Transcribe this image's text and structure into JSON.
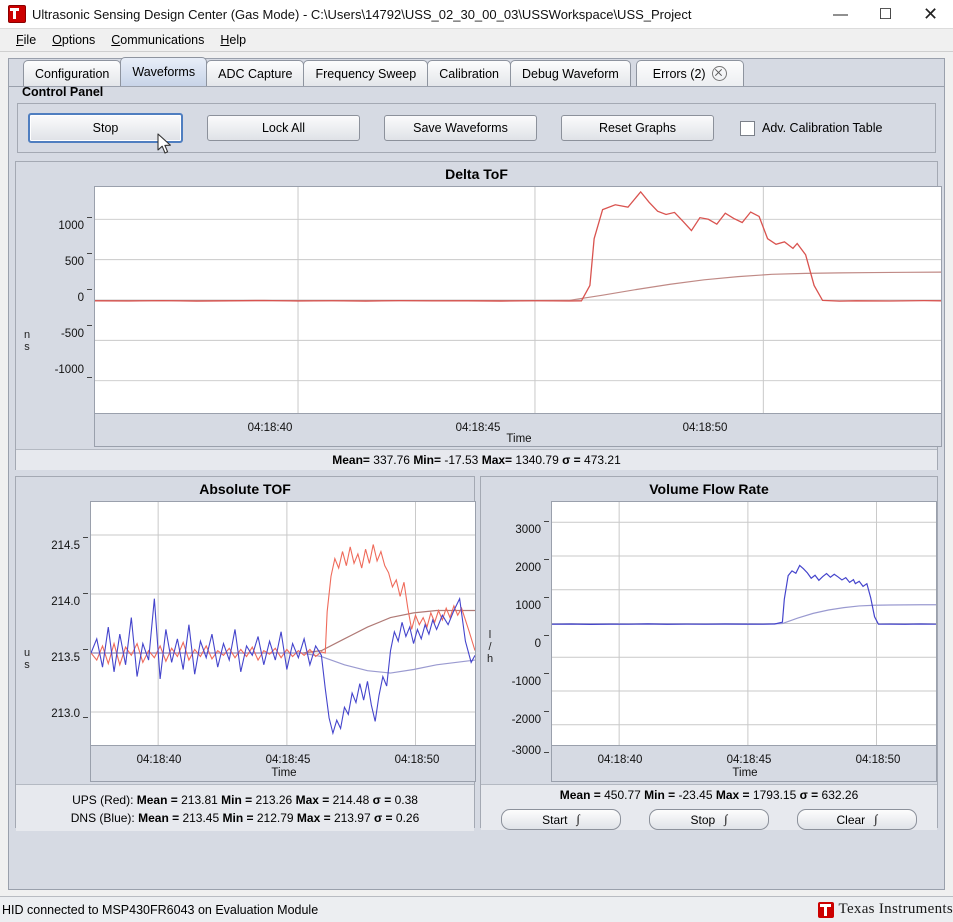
{
  "window": {
    "title": "Ultrasonic Sensing Design Center (Gas Mode) - C:\\Users\\14792\\USS_02_30_00_03\\USSWorkspace\\USS_Project",
    "icon": "app-icon",
    "minimize": "—",
    "maximize": "☐",
    "close": "✕"
  },
  "menu": [
    {
      "label": "File"
    },
    {
      "label": "Options"
    },
    {
      "label": "Communications"
    },
    {
      "label": "Help"
    }
  ],
  "tabs": [
    {
      "label": "Configuration",
      "active": false
    },
    {
      "label": "Waveforms",
      "active": true
    },
    {
      "label": "ADC Capture",
      "active": false
    },
    {
      "label": "Frequency Sweep",
      "active": false
    },
    {
      "label": "Calibration",
      "active": false
    },
    {
      "label": "Debug Waveform",
      "active": false
    },
    {
      "label": "Errors (2)",
      "active": false,
      "closable": true
    }
  ],
  "control_panel": {
    "title": "Control Panel",
    "stop_button": "Stop",
    "lock_all_button": "Lock All",
    "save_waveforms_button": "Save Waveforms",
    "reset_graphs_button": "Reset Graphs",
    "adv_calibration_checkbox": "Adv. Calibration Table",
    "adv_calibration_checked": false
  },
  "delta_tof": {
    "title": "Delta ToF",
    "stats": {
      "mean_label": "Mean=",
      "mean": "337.76",
      "min_label": "Min=",
      "min": "-17.53",
      "max_label": "Max=",
      "max": "1340.79",
      "sigma_label": "σ =",
      "sigma": "473.21"
    }
  },
  "absolute_tof": {
    "title": "Absolute TOF",
    "ups_label": "UPS (Red):",
    "ups": {
      "mean_label": "Mean =",
      "mean": "213.81",
      "min_label": "Min =",
      "min": "213.26",
      "max_label": "Max =",
      "max": "214.48",
      "sigma_label": "σ =",
      "sigma": "0.38"
    },
    "dns_label": "DNS (Blue):",
    "dns": {
      "mean_label": "Mean =",
      "mean": "213.45",
      "min_label": "Min =",
      "min": "212.79",
      "max_label": "Max =",
      "max": "213.97",
      "sigma_label": "σ =",
      "sigma": "0.26"
    }
  },
  "volume_flow_rate": {
    "title": "Volume Flow Rate",
    "stats": {
      "mean_label": "Mean =",
      "mean": "450.77",
      "min_label": "Min =",
      "min": "-23.45",
      "max_label": "Max =",
      "max": "1793.15",
      "sigma_label": "σ =",
      "sigma": "632.26"
    },
    "start_button": "Start",
    "stop_button": "Stop",
    "clear_button": "Clear",
    "totalizer_glyph": "∫"
  },
  "statusbar": {
    "text": "HID connected to MSP430FR6043 on Evaluation Module",
    "brand": "Texas Instruments"
  },
  "colors": {
    "ups_red": "#d9534f",
    "dns_blue": "#4444cc",
    "avg_red": "#c08a86",
    "avg_blue": "#9a9ad0",
    "panel": "#d6dae3",
    "plot_bg": "#ffffff",
    "grid": "#c8c8c8",
    "accent_focus": "#4f7ec0",
    "ti_red": "#cc0000"
  },
  "chart_data": [
    {
      "type": "line",
      "name": "delta-tof",
      "title": "Delta ToF",
      "xlabel": "Time",
      "ylabel": "ns",
      "ylim": [
        -1400,
        1400
      ],
      "yticks": [
        1000,
        500,
        0,
        -500,
        -1000
      ],
      "ytick_labels": [
        "1000",
        "500",
        "0",
        "-500",
        "-1000"
      ],
      "xticks": [
        "04:18:40",
        "04:18:45",
        "04:18:50"
      ],
      "xtick_positions": [
        0.24,
        0.52,
        0.79
      ],
      "grid": true,
      "legend": "none",
      "series": [
        {
          "name": "Delta ToF",
          "color": "#d9534f",
          "x": [
            0.0,
            0.04,
            0.08,
            0.12,
            0.16,
            0.2,
            0.24,
            0.28,
            0.32,
            0.36,
            0.4,
            0.44,
            0.48,
            0.52,
            0.56,
            0.575,
            0.585,
            0.59,
            0.6,
            0.615,
            0.63,
            0.645,
            0.655,
            0.665,
            0.675,
            0.685,
            0.695,
            0.705,
            0.715,
            0.725,
            0.735,
            0.745,
            0.755,
            0.765,
            0.775,
            0.785,
            0.795,
            0.805,
            0.815,
            0.825,
            0.83,
            0.84,
            0.85,
            0.86,
            0.88,
            0.9,
            0.94,
            0.98,
            1.0
          ],
          "y": [
            -10,
            -12,
            -8,
            -14,
            -10,
            -6,
            -12,
            -9,
            -14,
            -8,
            -11,
            -10,
            -13,
            -9,
            -12,
            -10,
            180,
            760,
            1120,
            1180,
            1150,
            1340,
            1210,
            1100,
            1060,
            1085,
            975,
            860,
            1020,
            1000,
            940,
            1075,
            1010,
            960,
            1090,
            1035,
            760,
            690,
            720,
            640,
            700,
            560,
            180,
            -5,
            -14,
            -10,
            -12,
            -8,
            -10
          ]
        },
        {
          "name": "Delta ToF (average)",
          "color": "#c08a86",
          "x": [
            0.0,
            0.2,
            0.4,
            0.52,
            0.56,
            0.6,
            0.64,
            0.68,
            0.72,
            0.76,
            0.8,
            0.84,
            0.88,
            0.92,
            0.96,
            1.0
          ],
          "y": [
            -8,
            -8,
            -8,
            -8,
            -5,
            60,
            130,
            195,
            250,
            290,
            318,
            330,
            336,
            340,
            343,
            345
          ]
        }
      ],
      "stats": {
        "mean": 337.76,
        "min": -17.53,
        "max": 1340.79,
        "sigma": 473.21
      }
    },
    {
      "type": "line",
      "name": "absolute-tof",
      "title": "Absolute TOF",
      "xlabel": "Time",
      "ylabel": "us",
      "ylim": [
        212.72,
        214.78
      ],
      "yticks": [
        214.5,
        214.0,
        213.5,
        213.0
      ],
      "ytick_labels": [
        "214.5",
        "214.0",
        "213.5",
        "213.0"
      ],
      "xticks": [
        "04:18:40",
        "04:18:45",
        "04:18:50"
      ],
      "xtick_positions": [
        0.175,
        0.51,
        0.845
      ],
      "grid": true,
      "legend": "none",
      "series": [
        {
          "name": "UPS (Red)",
          "color": "#ef6a5a",
          "x": [
            0.0,
            0.015,
            0.03,
            0.045,
            0.06,
            0.075,
            0.09,
            0.105,
            0.12,
            0.135,
            0.15,
            0.165,
            0.18,
            0.195,
            0.21,
            0.225,
            0.24,
            0.255,
            0.27,
            0.285,
            0.3,
            0.315,
            0.33,
            0.345,
            0.36,
            0.375,
            0.39,
            0.405,
            0.42,
            0.435,
            0.45,
            0.465,
            0.48,
            0.495,
            0.51,
            0.525,
            0.54,
            0.555,
            0.57,
            0.585,
            0.6,
            0.61,
            0.615,
            0.625,
            0.635,
            0.645,
            0.655,
            0.665,
            0.675,
            0.685,
            0.695,
            0.705,
            0.715,
            0.725,
            0.735,
            0.745,
            0.755,
            0.765,
            0.775,
            0.785,
            0.795,
            0.805,
            0.815,
            0.825,
            0.835,
            0.845,
            0.855,
            0.865,
            0.875,
            0.885,
            0.895,
            0.905,
            0.915,
            0.925,
            0.935,
            0.945,
            0.955,
            0.965,
            0.975,
            0.985,
            1.0
          ],
          "y": [
            213.5,
            213.44,
            213.56,
            213.41,
            213.58,
            213.4,
            213.55,
            213.48,
            213.58,
            213.42,
            213.52,
            213.46,
            213.56,
            213.43,
            213.54,
            213.47,
            213.59,
            213.44,
            213.53,
            213.47,
            213.56,
            213.45,
            213.52,
            213.48,
            213.54,
            213.46,
            213.53,
            213.47,
            213.55,
            213.44,
            213.52,
            213.49,
            213.54,
            213.46,
            213.53,
            213.47,
            213.52,
            213.48,
            213.53,
            213.47,
            213.51,
            213.5,
            213.85,
            214.15,
            214.3,
            214.22,
            214.36,
            214.24,
            214.4,
            214.26,
            214.34,
            214.22,
            214.38,
            214.26,
            214.42,
            214.28,
            214.36,
            214.24,
            214.18,
            214.06,
            214.12,
            213.98,
            214.1,
            213.88,
            213.7,
            213.82,
            213.74,
            213.8,
            213.72,
            213.84,
            213.76,
            213.86,
            213.78,
            213.88,
            213.8,
            213.9,
            213.82,
            213.88,
            213.78,
            213.68,
            213.52
          ]
        },
        {
          "name": "DNS (Blue)",
          "color": "#4444cc",
          "x": [
            0.0,
            0.015,
            0.03,
            0.045,
            0.06,
            0.075,
            0.09,
            0.105,
            0.12,
            0.135,
            0.15,
            0.165,
            0.18,
            0.195,
            0.21,
            0.225,
            0.24,
            0.255,
            0.27,
            0.285,
            0.3,
            0.315,
            0.33,
            0.345,
            0.36,
            0.375,
            0.39,
            0.405,
            0.42,
            0.435,
            0.45,
            0.465,
            0.48,
            0.495,
            0.51,
            0.525,
            0.54,
            0.555,
            0.57,
            0.585,
            0.6,
            0.61,
            0.62,
            0.63,
            0.64,
            0.65,
            0.66,
            0.67,
            0.68,
            0.69,
            0.7,
            0.71,
            0.72,
            0.73,
            0.74,
            0.75,
            0.76,
            0.77,
            0.78,
            0.79,
            0.8,
            0.81,
            0.82,
            0.83,
            0.84,
            0.85,
            0.86,
            0.87,
            0.88,
            0.89,
            0.9,
            0.915,
            0.93,
            0.945,
            0.96,
            0.975,
            0.99,
            1.0
          ],
          "y": [
            213.5,
            213.62,
            213.38,
            213.72,
            213.34,
            213.66,
            213.4,
            213.8,
            213.3,
            213.58,
            213.44,
            213.96,
            213.28,
            213.7,
            213.42,
            213.62,
            213.36,
            213.74,
            213.32,
            213.6,
            213.46,
            213.66,
            213.38,
            213.58,
            213.44,
            213.7,
            213.34,
            213.56,
            213.48,
            213.64,
            213.4,
            213.6,
            213.44,
            213.68,
            213.36,
            213.58,
            213.46,
            213.62,
            213.4,
            213.56,
            213.48,
            213.2,
            212.95,
            212.82,
            212.93,
            212.86,
            213.04,
            212.98,
            213.16,
            213.08,
            213.24,
            213.1,
            213.26,
            213.06,
            212.92,
            213.14,
            213.3,
            213.22,
            213.52,
            213.68,
            213.6,
            213.76,
            213.64,
            213.72,
            213.58,
            213.7,
            213.62,
            213.74,
            213.66,
            213.78,
            213.7,
            213.82,
            213.74,
            213.86,
            213.96,
            213.6,
            213.42,
            213.48
          ]
        },
        {
          "name": "UPS average",
          "color": "#b07a76",
          "x": [
            0.0,
            0.3,
            0.55,
            0.6,
            0.66,
            0.72,
            0.78,
            0.84,
            0.9,
            1.0
          ],
          "y": [
            213.5,
            213.5,
            213.5,
            213.52,
            213.62,
            213.72,
            213.8,
            213.84,
            213.86,
            213.86
          ]
        },
        {
          "name": "DNS average",
          "color": "#9a9ad0",
          "x": [
            0.0,
            0.3,
            0.55,
            0.6,
            0.66,
            0.72,
            0.78,
            0.84,
            0.9,
            1.0
          ],
          "y": [
            213.5,
            213.5,
            213.5,
            213.47,
            213.4,
            213.35,
            213.33,
            213.36,
            213.4,
            213.44
          ]
        }
      ],
      "stats": {
        "ups": {
          "mean": 213.81,
          "min": 213.26,
          "max": 214.48,
          "sigma": 0.38
        },
        "dns": {
          "mean": 213.45,
          "min": 212.79,
          "max": 213.97,
          "sigma": 0.26
        }
      }
    },
    {
      "type": "line",
      "name": "volume-flow-rate",
      "title": "Volume Flow Rate",
      "xlabel": "Time",
      "ylabel": "l/h",
      "ylim": [
        -3600,
        3600
      ],
      "yticks": [
        3000,
        2000,
        1000,
        0,
        -1000,
        -2000,
        -3000
      ],
      "ytick_labels": [
        "3000",
        "2000",
        "1000",
        "0",
        "-1000",
        "-2000",
        "-3000"
      ],
      "xticks": [
        "04:18:40",
        "04:18:45",
        "04:18:50"
      ],
      "xtick_positions": [
        0.175,
        0.51,
        0.845
      ],
      "grid": true,
      "legend": "none",
      "series": [
        {
          "name": "Volume Flow Rate",
          "color": "#4444cc",
          "x": [
            0.0,
            0.05,
            0.1,
            0.15,
            0.2,
            0.25,
            0.3,
            0.35,
            0.4,
            0.45,
            0.5,
            0.55,
            0.58,
            0.6,
            0.605,
            0.615,
            0.625,
            0.635,
            0.645,
            0.655,
            0.665,
            0.675,
            0.685,
            0.695,
            0.705,
            0.715,
            0.725,
            0.735,
            0.745,
            0.755,
            0.765,
            0.775,
            0.785,
            0.79,
            0.8,
            0.81,
            0.82,
            0.83,
            0.84,
            0.85,
            0.88,
            0.92,
            0.96,
            1.0
          ],
          "y": [
            -20,
            -15,
            -25,
            -18,
            -20,
            -12,
            -22,
            -16,
            -20,
            -14,
            -18,
            -20,
            -15,
            40,
            720,
            1420,
            1560,
            1490,
            1720,
            1620,
            1500,
            1340,
            1430,
            1280,
            1390,
            1480,
            1370,
            1460,
            1380,
            1290,
            1360,
            1220,
            1300,
            1180,
            1250,
            1100,
            1180,
            760,
            200,
            -20,
            -18,
            -22,
            -15,
            -20
          ]
        },
        {
          "name": "Volume Flow Rate (average)",
          "color": "#9a9ad0",
          "x": [
            0.0,
            0.3,
            0.55,
            0.6,
            0.64,
            0.68,
            0.72,
            0.76,
            0.8,
            0.84,
            0.88,
            0.92,
            0.96,
            1.0
          ],
          "y": [
            -18,
            -18,
            -18,
            0,
            160,
            300,
            400,
            470,
            520,
            540,
            548,
            552,
            555,
            556
          ]
        }
      ],
      "stats": {
        "mean": 450.77,
        "min": -23.45,
        "max": 1793.15,
        "sigma": 632.26
      }
    }
  ]
}
